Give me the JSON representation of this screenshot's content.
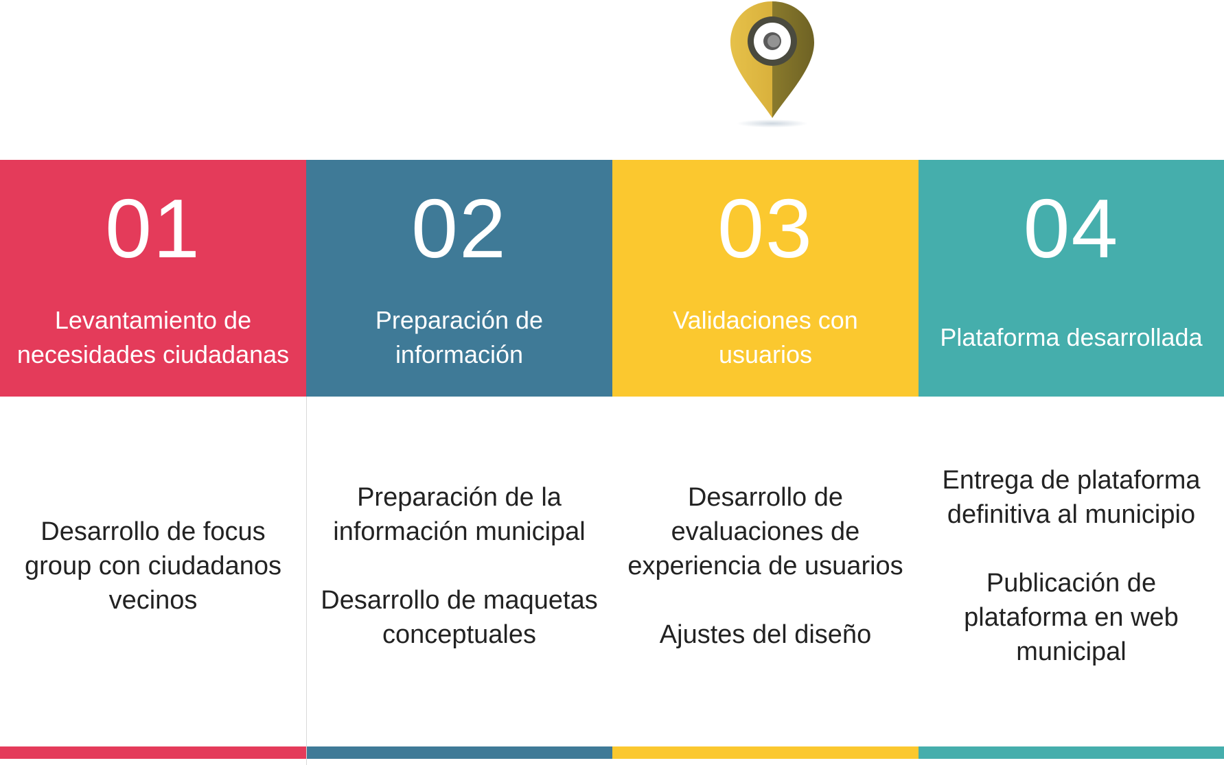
{
  "steps": [
    {
      "number": "01",
      "title": "Levantamiento de\nnecesidades ciudadanas",
      "details": [
        "Desarrollo de focus\ngroup con ciudadanos\nvecinos"
      ],
      "color": "#e43b5a"
    },
    {
      "number": "02",
      "title": "Preparación de\ninformación",
      "details": [
        "Preparación de la\ninformación municipal",
        "Desarrollo de maquetas\nconceptuales"
      ],
      "color": "#3f7a97"
    },
    {
      "number": "03",
      "title": "Validaciones con\nusuarios",
      "details": [
        "Desarrollo de\nevaluaciones de\nexperiencia de usuarios",
        "Ajustes del diseño"
      ],
      "color": "#fbc82f"
    },
    {
      "number": "04",
      "title": "Plataforma desarrollada",
      "details": [
        "Entrega de plataforma\ndefinitiva al municipio",
        "Publicación de\nplataforma en web\nmunicipal"
      ],
      "color": "#45aeac"
    }
  ],
  "marker": {
    "icon": "location-pin-icon",
    "color": "#c9a33a"
  }
}
